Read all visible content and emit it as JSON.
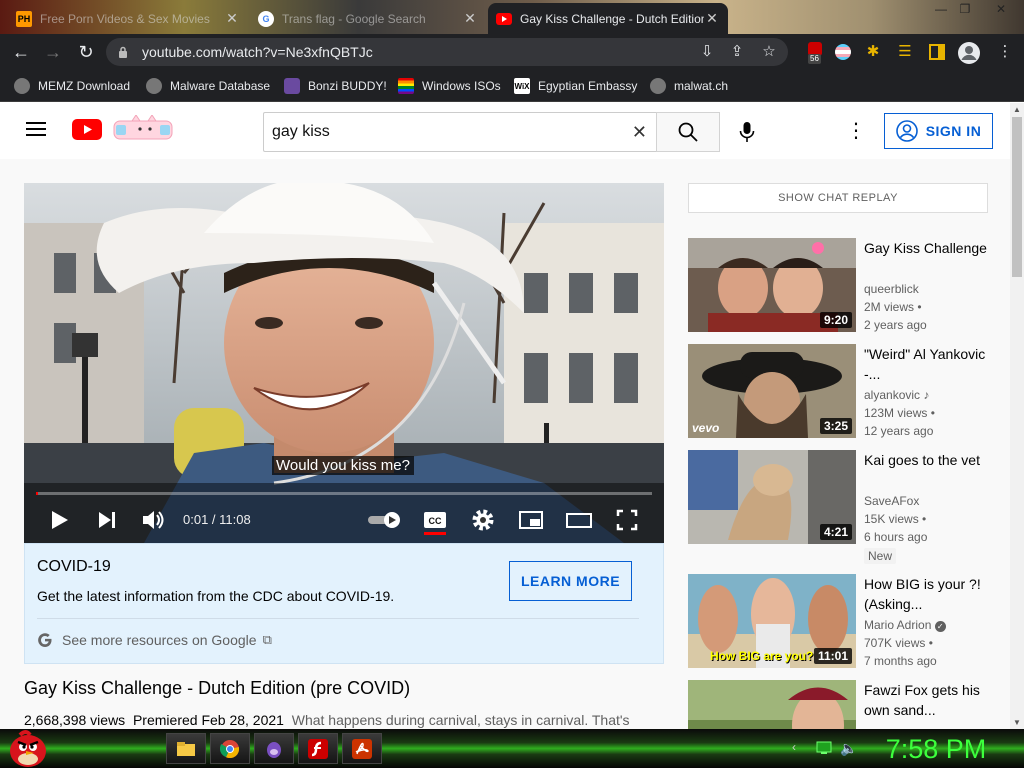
{
  "browser": {
    "tabs": [
      {
        "title": "Free Porn Videos & Sex Movies",
        "favicon": "PH"
      },
      {
        "title": "Trans flag - Google Search",
        "favicon": "G"
      },
      {
        "title": "Gay Kiss Challenge - Dutch Edition",
        "favicon": "youtube-icon"
      }
    ],
    "url": "youtube.com/watch?v=Ne3xfnQBTJc",
    "extension_badge": "56",
    "bookmarks": [
      {
        "label": "MEMZ Download"
      },
      {
        "label": "Malware Database"
      },
      {
        "label": "Bonzi BUDDY!"
      },
      {
        "label": "Windows ISOs"
      },
      {
        "label": "Egyptian Embassy",
        "icon_text": "WiX"
      },
      {
        "label": "malwat.ch"
      }
    ]
  },
  "youtube": {
    "search_value": "gay kiss",
    "sign_in": "SIGN IN",
    "player": {
      "caption": "Would you kiss me?",
      "time": "0:01 / 11:08"
    },
    "covid": {
      "title": "COVID-19",
      "desc": "Get the latest information from the CDC about COVID-19.",
      "button": "LEARN MORE",
      "more": "See more resources on Google"
    },
    "video": {
      "title": "Gay Kiss Challenge - Dutch Edition (pre COVID)",
      "views": "2,668,398 views",
      "premiered": "Premiered Feb 28, 2021",
      "description": "What happens during carnival, stays in carnival. That's"
    },
    "chat_replay": "SHOW CHAT REPLAY",
    "recommendations": [
      {
        "title": "Gay Kiss Challenge",
        "channel": "queerblick",
        "views": "2M views •",
        "age": "2 years ago",
        "duration": "9:20"
      },
      {
        "title": "\"Weird\" Al Yankovic -...",
        "channel": "alyankovic",
        "views": "123M views •",
        "age": "12 years ago",
        "duration": "3:25",
        "thumb_text": "vevo"
      },
      {
        "title": "Kai goes to the vet",
        "channel": "SaveAFox",
        "views": "15K views •",
        "age": "6 hours ago",
        "duration": "4:21",
        "badge": "New"
      },
      {
        "title": "How BIG is your ?! (Asking...",
        "channel": "Mario Adrion",
        "views": "707K views •",
        "age": "7 months ago",
        "duration": "11:01",
        "thumb_text": "How BIG are you?"
      },
      {
        "title": "Fawzi Fox gets his own sand..."
      }
    ]
  },
  "taskbar": {
    "clock": "7:58 PM"
  },
  "colors": {
    "youtube_red": "#ff0000",
    "link_blue": "#065fd4",
    "chrome_dark": "#202124",
    "clock_green": "#3cff3c"
  }
}
